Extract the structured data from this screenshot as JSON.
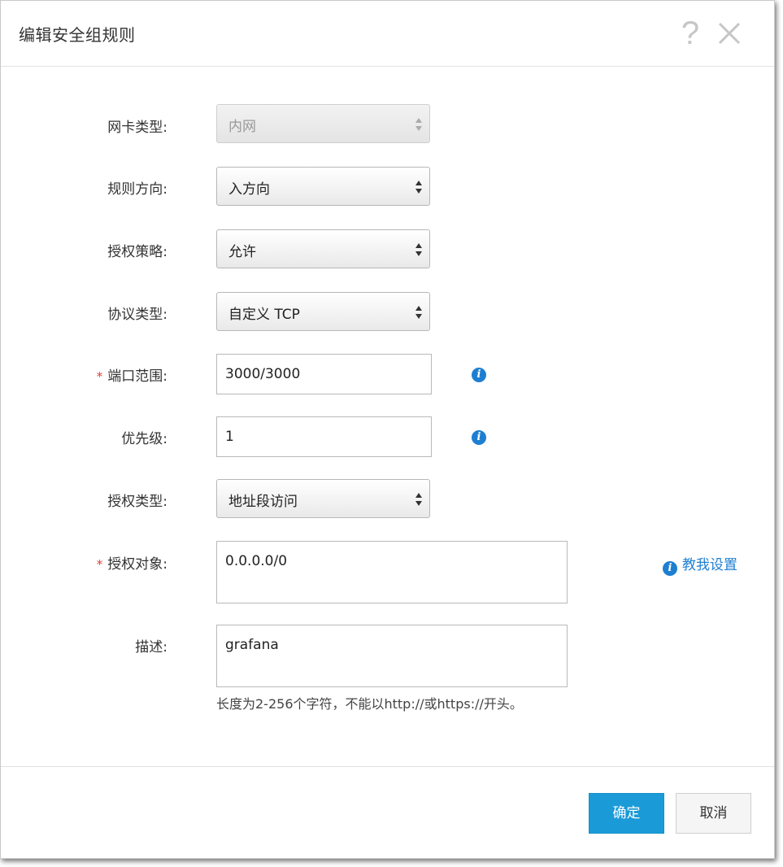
{
  "dialog": {
    "title": "编辑安全组规则",
    "help_icon": "question-mark-icon",
    "close_icon": "close-icon"
  },
  "form": {
    "nic_type": {
      "label": "网卡类型:",
      "value": "内网",
      "disabled": true
    },
    "rule_direction": {
      "label": "规则方向:",
      "value": "入方向"
    },
    "auth_policy": {
      "label": "授权策略:",
      "value": "允许"
    },
    "protocol_type": {
      "label": "协议类型:",
      "value": "自定义 TCP"
    },
    "port_range": {
      "label": "端口范围:",
      "required_mark": "*",
      "value": "3000/3000"
    },
    "priority": {
      "label": "优先级:",
      "value": "1"
    },
    "auth_type": {
      "label": "授权类型:",
      "value": "地址段访问"
    },
    "auth_object": {
      "label": "授权对象:",
      "required_mark": "*",
      "value": "0.0.0.0/0",
      "help_link": "教我设置"
    },
    "description": {
      "label": "描述:",
      "value": "grafana",
      "hint": "长度为2-256个字符，不能以http://或https://开头。"
    }
  },
  "info_icon_glyph": "i",
  "footer": {
    "ok_label": "确定",
    "cancel_label": "取消"
  },
  "colors": {
    "primary_button": "#1a9bd7",
    "link": "#1e7fd1",
    "required": "#e53935"
  }
}
